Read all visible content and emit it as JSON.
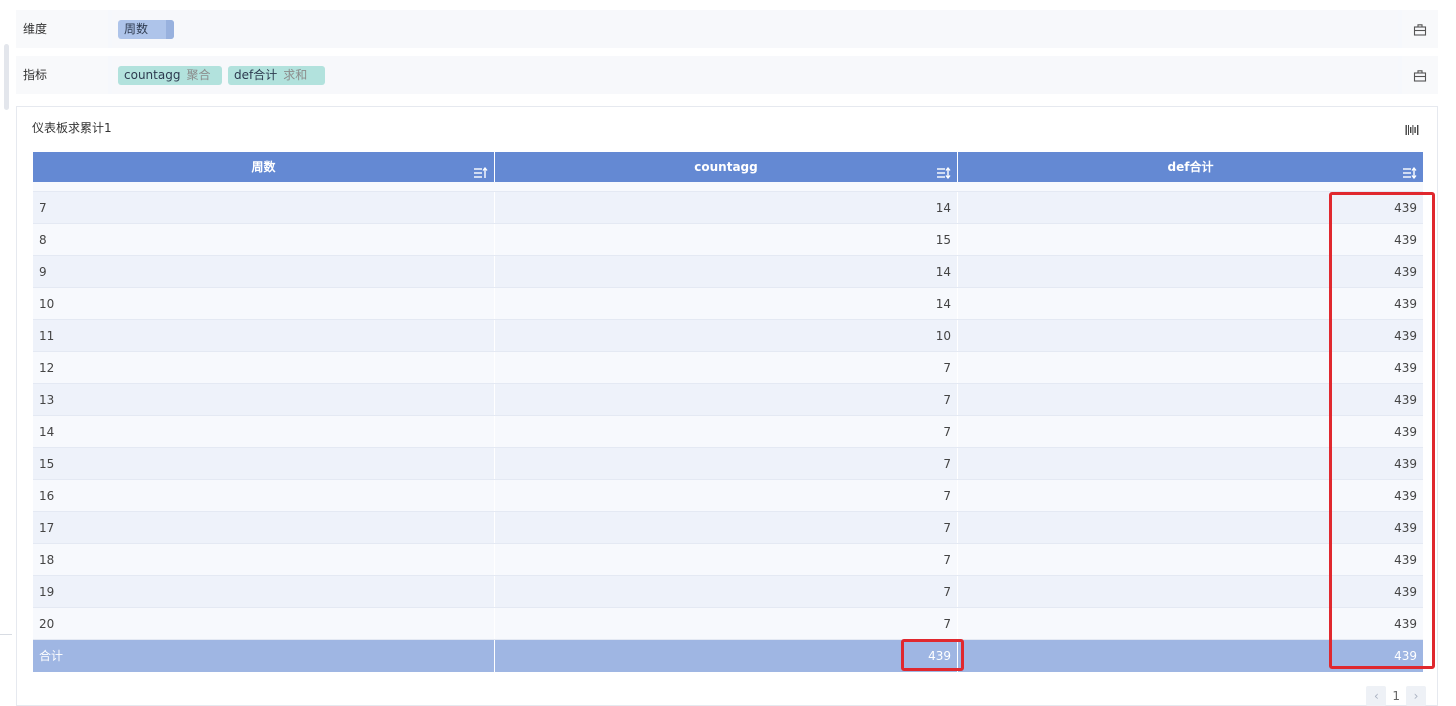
{
  "dimension_row": {
    "label": "维度",
    "chips": [
      {
        "name": "周数"
      }
    ]
  },
  "metric_row": {
    "label": "指标",
    "chips": [
      {
        "name": "countagg",
        "agg": "聚合"
      },
      {
        "name": "def合计",
        "agg": "求和"
      }
    ]
  },
  "panel": {
    "title": "仪表板求累计1"
  },
  "table": {
    "headers": [
      "周数",
      "countagg",
      "def合计"
    ],
    "rows": [
      {
        "week": "7",
        "countagg": "14",
        "def": "439"
      },
      {
        "week": "8",
        "countagg": "15",
        "def": "439"
      },
      {
        "week": "9",
        "countagg": "14",
        "def": "439"
      },
      {
        "week": "10",
        "countagg": "14",
        "def": "439"
      },
      {
        "week": "11",
        "countagg": "10",
        "def": "439"
      },
      {
        "week": "12",
        "countagg": "7",
        "def": "439"
      },
      {
        "week": "13",
        "countagg": "7",
        "def": "439"
      },
      {
        "week": "14",
        "countagg": "7",
        "def": "439"
      },
      {
        "week": "15",
        "countagg": "7",
        "def": "439"
      },
      {
        "week": "16",
        "countagg": "7",
        "def": "439"
      },
      {
        "week": "17",
        "countagg": "7",
        "def": "439"
      },
      {
        "week": "18",
        "countagg": "7",
        "def": "439"
      },
      {
        "week": "19",
        "countagg": "7",
        "def": "439"
      },
      {
        "week": "20",
        "countagg": "7",
        "def": "439"
      }
    ],
    "total": {
      "label": "合计",
      "countagg": "439",
      "def": "439"
    }
  },
  "pager": {
    "page": "1"
  },
  "colors": {
    "header_bg": "#6489d3",
    "total_bg": "#9fb6e3",
    "dimension_chip": "#aec4ea",
    "metric_chip": "#b2e2dd",
    "highlight": "#e0282e"
  },
  "icons": {
    "field_config": "toolbox-icon",
    "chart_type": "barcode-chart-icon",
    "sort_asc": "sort-ascending-icon",
    "sort_both": "sort-both-icon"
  }
}
